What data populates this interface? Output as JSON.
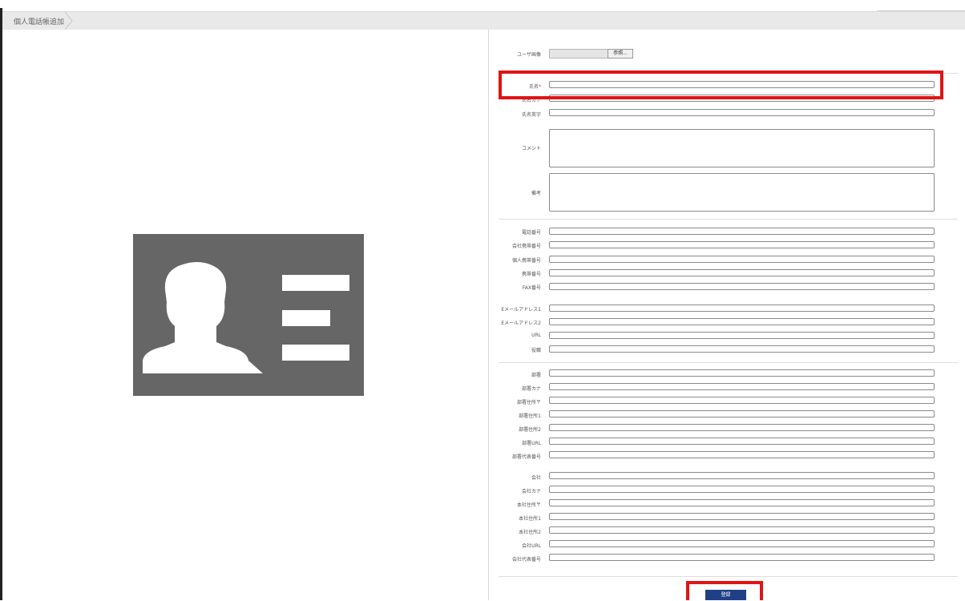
{
  "breadcrumb": {
    "title": "個人電話帳追加"
  },
  "form": {
    "user_image_label": "ユーザ画像",
    "browse_label": "参照...",
    "name_label": "氏名",
    "required_mark": "*",
    "name_kana_label": "氏名カナ",
    "name_roman_label": "氏名英字",
    "comment_label": "コメント",
    "memo_label": "備考",
    "contact_fields": [
      {
        "label": "電話番号"
      },
      {
        "label": "会社携帯番号"
      },
      {
        "label": "個人携帯番号"
      },
      {
        "label": "携帯番号"
      },
      {
        "label": "FAX番号"
      }
    ],
    "email_fields": [
      {
        "label": "Eメールアドレス1"
      },
      {
        "label": "Eメールアドレス2"
      },
      {
        "label": "URL"
      },
      {
        "label": "役職"
      }
    ],
    "dept_fields": [
      {
        "label": "部署"
      },
      {
        "label": "部署カナ"
      },
      {
        "label": "部署住所〒"
      },
      {
        "label": "部署住所1"
      },
      {
        "label": "部署住所2"
      },
      {
        "label": "部署URL"
      },
      {
        "label": "部署代表番号"
      }
    ],
    "company_fields": [
      {
        "label": "会社"
      },
      {
        "label": "会社カナ"
      },
      {
        "label": "本社住所〒"
      },
      {
        "label": "本社住所1"
      },
      {
        "label": "本社住所2"
      },
      {
        "label": "会社URL"
      },
      {
        "label": "会社代表番号"
      }
    ],
    "submit_label": "登録"
  },
  "colors": {
    "accent": "#1f3f87",
    "highlight": "#e01414",
    "placeholder_card": "#666666"
  },
  "icons": {
    "placeholder": "contact-card-icon"
  }
}
